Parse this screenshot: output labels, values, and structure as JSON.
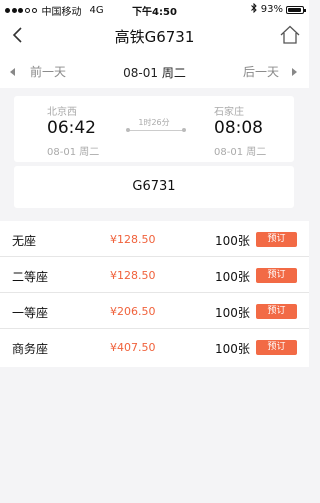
{
  "status_bar": {
    "carrier": "中国移动",
    "network": "4G",
    "time": "下午4:50",
    "battery": "93%",
    "battery_level": 0.93
  },
  "nav": {
    "title": "高铁G6731",
    "back_icon": "chevron-left-icon",
    "home_icon": "home-icon"
  },
  "date_bar": {
    "prev_label": "前一天",
    "date": "08-01 周二",
    "next_label": "后一天"
  },
  "trip": {
    "from_station": "北京西",
    "from_time": "06:42",
    "from_date": "08-01 周二",
    "duration": "1时26分",
    "to_station": "石家庄",
    "to_time": "08:08",
    "to_date": "08-01 周二",
    "train_no": "G6731"
  },
  "seats": [
    {
      "name": "无座",
      "price": "¥128.50",
      "count": "100张",
      "button": "预订"
    },
    {
      "name": "二等座",
      "price": "¥128.50",
      "count": "100张",
      "button": "预订"
    },
    {
      "name": "一等座",
      "price": "¥206.50",
      "count": "100张",
      "button": "预订"
    },
    {
      "name": "商务座",
      "price": "¥407.50",
      "count": "100张",
      "button": "预订"
    }
  ],
  "colors": {
    "accent": "#f26a45",
    "price": "#f0623c",
    "background": "#f4f4f6"
  }
}
